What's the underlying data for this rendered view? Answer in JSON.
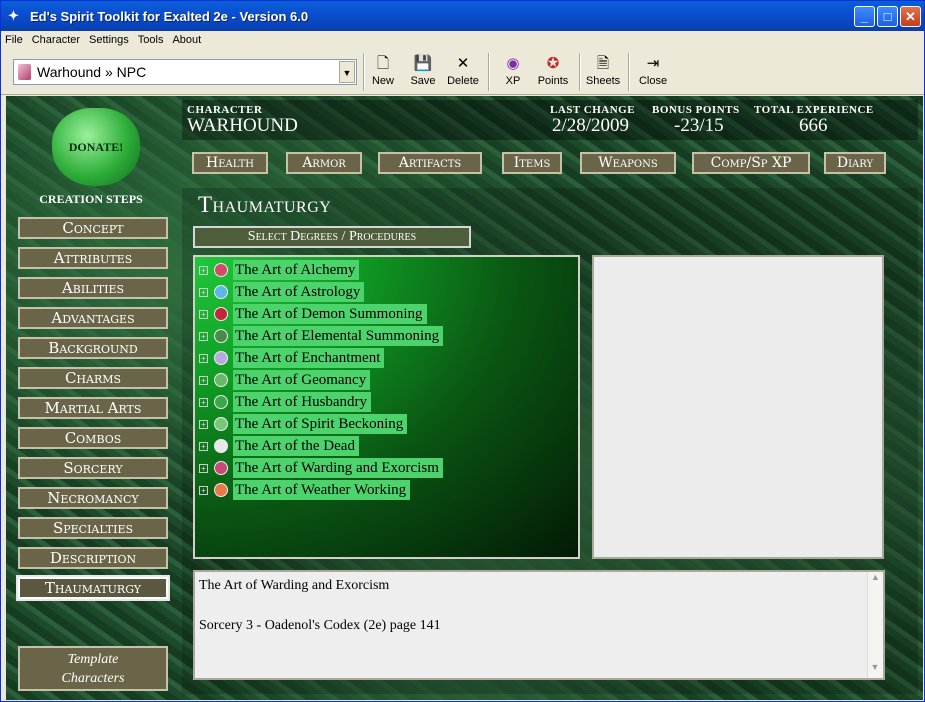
{
  "window": {
    "title": "Ed's Spirit Toolkit for Exalted 2e - Version 6.0"
  },
  "menu": [
    "File",
    "Character",
    "Settings",
    "Tools",
    "About"
  ],
  "toolbar": {
    "selector": "Warhound » NPC",
    "buttons": [
      {
        "label": "New",
        "icon": "new-file-icon"
      },
      {
        "label": "Save",
        "icon": "save-icon"
      },
      {
        "label": "Delete",
        "icon": "delete-icon"
      },
      {
        "label": "XP",
        "icon": "xp-icon"
      },
      {
        "label": "Points",
        "icon": "points-icon"
      },
      {
        "label": "Sheets",
        "icon": "sheets-icon"
      },
      {
        "label": "Close",
        "icon": "close-door-icon"
      }
    ]
  },
  "sidebar": {
    "donate": "DONATE!",
    "title": "CREATION STEPS",
    "steps": [
      "Concept",
      "Attributes",
      "Abilities",
      "Advantages",
      "Background",
      "Charms",
      "Martial Arts",
      "Combos",
      "Sorcery",
      "Necromancy",
      "Specialties",
      "Description",
      "Thaumaturgy"
    ],
    "active": "Thaumaturgy",
    "template_line1": "Template",
    "template_line2": "Characters"
  },
  "header": {
    "character_label": "CHARACTER",
    "character_value": "WARHOUND",
    "last_change_label": "LAST CHANGE",
    "last_change_value": "2/28/2009",
    "bonus_label": "BONUS POINTS",
    "bonus_value": "-23/15",
    "total_label": "TOTAL EXPERIENCE",
    "total_value": "666"
  },
  "nav": [
    "Health",
    "Armor",
    "Artifacts",
    "Items",
    "Weapons",
    "Comp/Sp XP",
    "Diary"
  ],
  "panel": {
    "title": "Thaumaturgy",
    "select_button": "Select Degrees / Procedures",
    "tree": [
      {
        "label": "The Art of Alchemy",
        "color": "#d44a6a",
        "expand": "+"
      },
      {
        "label": "The Art of Astrology",
        "color": "#5ab8e8",
        "expand": "+"
      },
      {
        "label": "The Art of Demon Summoning",
        "color": "#c0283a",
        "expand": "+"
      },
      {
        "label": "The Art of Elemental Summoning",
        "color": "#4a8a4a",
        "expand": "+"
      },
      {
        "label": "The Art of Enchantment",
        "color": "#b8a8e0",
        "expand": "+"
      },
      {
        "label": "The Art of Geomancy",
        "color": "#6ab86a",
        "expand": "+"
      },
      {
        "label": "The Art of Husbandry",
        "color": "#3aa84a",
        "expand": "+"
      },
      {
        "label": "The Art of Spirit Beckoning",
        "color": "#78c878",
        "expand": "+"
      },
      {
        "label": "The Art of the Dead",
        "color": "#e8e8e8",
        "expand": "+"
      },
      {
        "label": "The Art of Warding and Exorcism",
        "color": "#c84878",
        "expand": "+"
      },
      {
        "label": "The Art of Weather Working",
        "color": "#e87848",
        "expand": "+"
      }
    ],
    "description_line1": "The Art of Warding and Exorcism",
    "description_line2": "Sorcery 3 - Oadenol's Codex (2e) page 141"
  }
}
